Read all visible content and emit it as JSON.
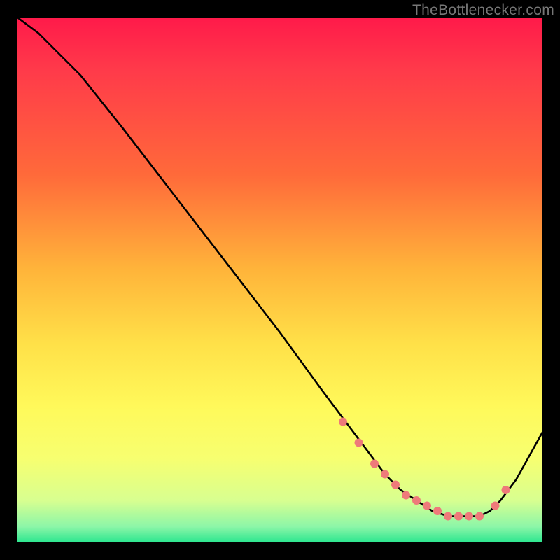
{
  "watermark": "TheBottlenecker.com",
  "chart_data": {
    "type": "line",
    "title": "",
    "xlabel": "",
    "ylabel": "",
    "xlim": [
      0,
      100
    ],
    "ylim": [
      0,
      100
    ],
    "background": "heatmap-gradient",
    "gradient_stops": [
      {
        "pos": 0,
        "color": "#ff1a4a"
      },
      {
        "pos": 10,
        "color": "#ff3a4a"
      },
      {
        "pos": 30,
        "color": "#ff6a3a"
      },
      {
        "pos": 48,
        "color": "#ffb43a"
      },
      {
        "pos": 62,
        "color": "#ffe048"
      },
      {
        "pos": 74,
        "color": "#fff95a"
      },
      {
        "pos": 84,
        "color": "#f7ff70"
      },
      {
        "pos": 92,
        "color": "#d8ff90"
      },
      {
        "pos": 97,
        "color": "#8cf6a8"
      },
      {
        "pos": 100,
        "color": "#2be68f"
      }
    ],
    "series": [
      {
        "name": "curve",
        "color": "#000000",
        "x": [
          0,
          4,
          7,
          12,
          20,
          30,
          40,
          50,
          58,
          64,
          67,
          70,
          73,
          76,
          79,
          82,
          85,
          88,
          90,
          92,
          95,
          100
        ],
        "y": [
          100,
          97,
          94,
          89,
          79,
          66,
          53,
          40,
          29,
          21,
          17,
          13,
          10,
          8,
          6,
          5,
          5,
          5,
          6,
          8,
          12,
          21
        ]
      }
    ],
    "markers": {
      "name": "highlight-dots",
      "color": "#ee7a7a",
      "radius": 5,
      "x": [
        62,
        65,
        68,
        70,
        72,
        74,
        76,
        78,
        80,
        82,
        84,
        86,
        88,
        91,
        93
      ],
      "y": [
        23,
        19,
        15,
        13,
        11,
        9,
        8,
        7,
        6,
        5,
        5,
        5,
        5,
        7,
        10
      ]
    }
  }
}
